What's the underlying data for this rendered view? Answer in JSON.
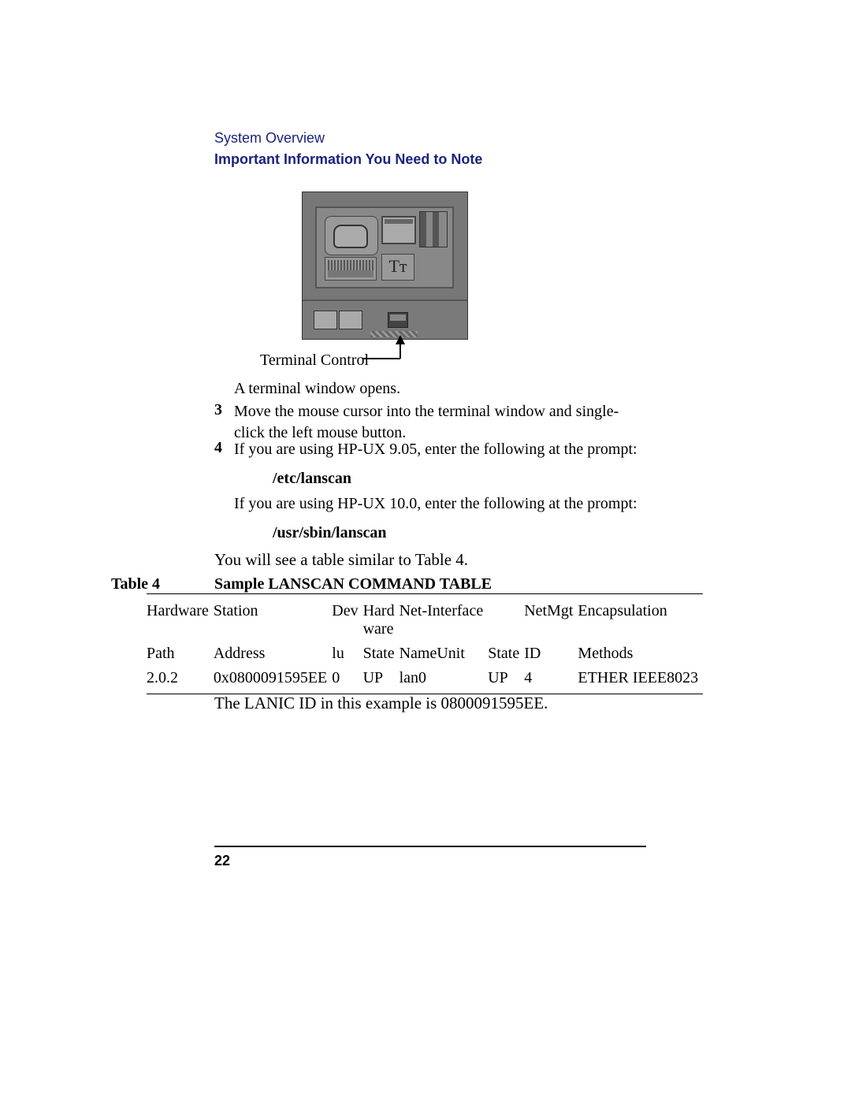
{
  "header": {
    "section": "System Overview",
    "subsection": "Important Information You Need to Note"
  },
  "figure": {
    "caption": "Terminal Control",
    "tt_glyph": "Tᴛ"
  },
  "body": {
    "terminal_opens": "A terminal window opens.",
    "step3_num": "3",
    "step3": "Move the mouse cursor into the terminal window and single-click the left mouse button.",
    "step4_num": "4",
    "step4": "If you are using HP-UX 9.05, enter the following at the prompt:",
    "cmd1": "/etc/lanscan",
    "hpux10": "If you are using HP-UX 10.0, enter the following at the prompt:",
    "cmd2": "/usr/sbin/lanscan",
    "you_will_see": "You will see a table similar to Table 4."
  },
  "table": {
    "label": "Table 4",
    "title": "Sample LANSCAN COMMAND TABLE",
    "header_row1": {
      "c0": "Hardware",
      "c1": "Station",
      "c2": "Dev",
      "c3": "Hard ware",
      "c4": "Net-Interface",
      "c5": "",
      "c6": "NetMgt",
      "c7": "Encapsulation"
    },
    "header_row2": {
      "c0": "Path",
      "c1": "Address",
      "c2": "lu",
      "c3": "State",
      "c4": "NameUnit",
      "c5": "State",
      "c6": "ID",
      "c7": "Methods"
    },
    "data_row": {
      "c0": "2.0.2",
      "c1": "0x0800091595EE",
      "c2": "0",
      "c3": "UP",
      "c4": "lan0",
      "c5": "UP",
      "c6": "4",
      "c7": "ETHER IEEE8023"
    }
  },
  "lanic_note": "The LANIC ID in this example is 0800091595EE.",
  "page_number": "22"
}
